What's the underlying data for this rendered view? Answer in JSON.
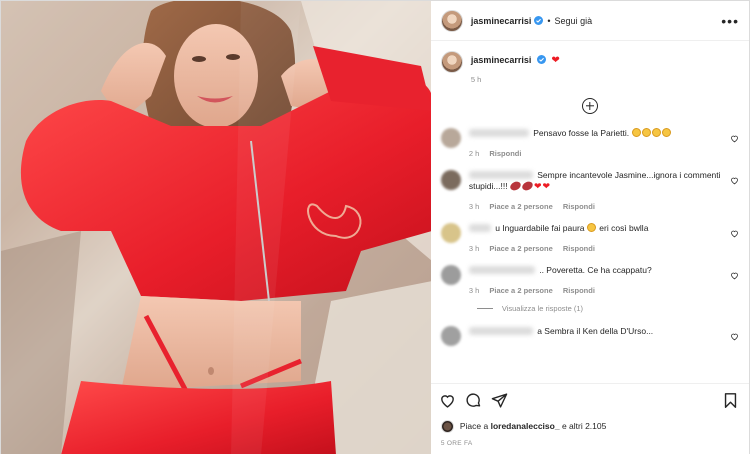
{
  "header": {
    "username": "jasminecarrisi",
    "separator": "•",
    "follow_label": "Segui già",
    "more_label": "•••"
  },
  "caption": {
    "username": "jasminecarrisi",
    "heart": "❤",
    "time": "5 h"
  },
  "comments": [
    {
      "text": "Pensavo fosse la Parietti.",
      "emoji": [
        "grin",
        "grin",
        "grin",
        "grin"
      ],
      "time": "2 h",
      "likes": "",
      "reply": "Rispondi",
      "avatar_color": "#b8a89a"
    },
    {
      "text": "Sempre incantevole Jasmine...ignora i commenti stupidi...!!!",
      "emoji": [
        "egg",
        "egg",
        "heart",
        "heart"
      ],
      "time": "3 h",
      "likes": "Piace a 2 persone",
      "reply": "Rispondi",
      "avatar_color": "#7b6b5e"
    },
    {
      "text": "u Inguardabile fai paura",
      "suffix": "eri così bwlla",
      "emoji": [
        "smile"
      ],
      "time": "3 h",
      "likes": "Piace a 2 persone",
      "reply": "Rispondi",
      "avatar_color": "#d8c48a"
    },
    {
      "text": ".. Poveretta. Ce ha ccappatu?",
      "emoji": [],
      "time": "3 h",
      "likes": "Piace a 2 persone",
      "reply": "Rispondi",
      "avatar_color": "#9c9c9c"
    },
    {
      "text": "a Sembra il Ken della D'Urso...",
      "emoji": [],
      "time": "",
      "likes": "",
      "reply": "",
      "avatar_color": "#a0a0a0"
    }
  ],
  "view_replies": "Visualizza le risposte (1)",
  "likes_row": {
    "prefix": "Piace a",
    "user": "loredanalecciso_",
    "suffix": "e altri 2.105"
  },
  "posted_ago": "5 ORE FA",
  "colors": {
    "accent_red": "#ed1c24",
    "verified_blue": "#3897f0",
    "meta_gray": "#8e8e8e"
  },
  "icons": [
    "like-icon",
    "comment-icon",
    "share-icon",
    "save-icon",
    "add-comment-icon",
    "verified-icon",
    "more-icon"
  ]
}
